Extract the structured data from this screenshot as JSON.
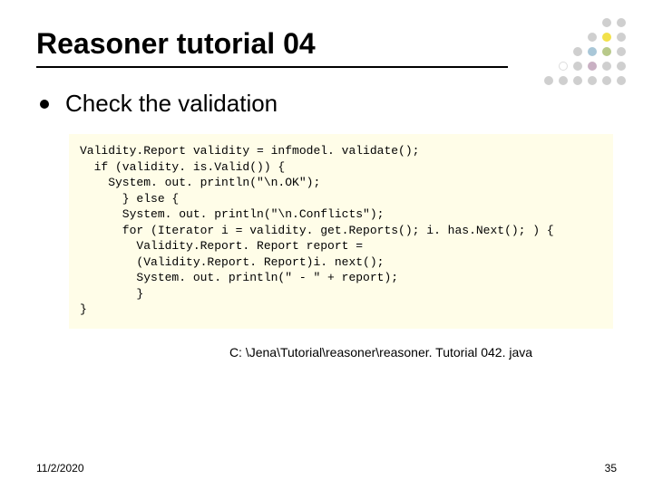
{
  "title": "Reasoner tutorial 04",
  "bullet": "Check the validation",
  "code": "Validity.Report validity = infmodel. validate();\n  if (validity. is.Valid()) {\n    System. out. println(\"\\n.OK\");\n      } else {\n      System. out. println(\"\\n.Conflicts\");\n      for (Iterator i = validity. get.Reports(); i. has.Next(); ) {\n        Validity.Report. Report report =\n        (Validity.Report. Report)i. next();\n        System. out. println(\" - \" + report);\n        }\n}",
  "path": "C: \\Jena\\Tutorial\\reasoner\\reasoner. Tutorial 042. java",
  "footer": {
    "date": "11/2/2020",
    "page": "35"
  }
}
